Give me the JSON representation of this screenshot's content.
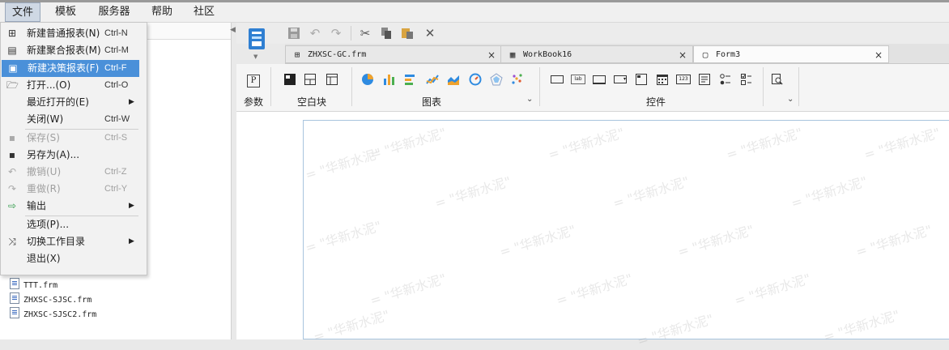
{
  "menubar": {
    "items": [
      {
        "label": "文件",
        "active": true
      },
      {
        "label": "模板"
      },
      {
        "label": "服务器"
      },
      {
        "label": "帮助"
      },
      {
        "label": "社区"
      }
    ]
  },
  "file_menu": {
    "items": [
      {
        "label": "新建普通报表(N)",
        "shortcut": "Ctrl-N",
        "icon": "grid-report-icon"
      },
      {
        "label": "新建聚合报表(M)",
        "shortcut": "Ctrl-M",
        "icon": "aggregate-report-icon"
      },
      {
        "label": "新建决策报表(F)",
        "shortcut": "Ctrl-F",
        "icon": "decision-report-icon",
        "highlighted": true
      },
      {
        "label": "打开...(O)",
        "shortcut": "Ctrl-O",
        "icon": "folder-open-icon"
      },
      {
        "label": "最近打开的(E)",
        "submenu": true
      },
      {
        "label": "关闭(W)",
        "shortcut": "Ctrl-W"
      },
      {
        "label": "保存(S)",
        "shortcut": "Ctrl-S",
        "icon": "save-icon",
        "disabled": true
      },
      {
        "label": "另存为(A)...",
        "icon": "save-as-icon"
      },
      {
        "label": "撤销(U)",
        "shortcut": "Ctrl-Z",
        "icon": "undo-icon",
        "disabled": true
      },
      {
        "label": "重做(R)",
        "shortcut": "Ctrl-Y",
        "icon": "redo-icon",
        "disabled": true
      },
      {
        "label": "输出",
        "icon": "export-icon",
        "submenu": true
      },
      {
        "label": "选项(P)..."
      },
      {
        "label": "切换工作目录",
        "icon": "shuffle-icon",
        "submenu": true
      },
      {
        "label": "退出(X)"
      }
    ],
    "submenu_arrow": "▶"
  },
  "file_tree": {
    "items": [
      "TTT.frm",
      "ZHXSC-SJSC.frm",
      "ZHXSC-SJSC2.frm"
    ]
  },
  "tabs": [
    {
      "label": "ZHXSC-GC.frm",
      "icon": "grid-report-icon",
      "close": "×"
    },
    {
      "label": "WorkBook16",
      "icon": "workbook-icon",
      "close": "×"
    },
    {
      "label": "Form3",
      "icon": "form-icon",
      "close": "×",
      "active": true
    }
  ],
  "ribbon": {
    "params_label": "参数",
    "blank_label": "空白块",
    "chart_label": "图表",
    "widget_label": "控件",
    "param_icon_text": "P",
    "lab_icon_text": "lab",
    "num_icon_text": "123"
  },
  "watermark": {
    "text": "= \"华新水泥\""
  },
  "colors": {
    "highlight": "#4a90d9",
    "canvas_border": "#a8c4de"
  }
}
